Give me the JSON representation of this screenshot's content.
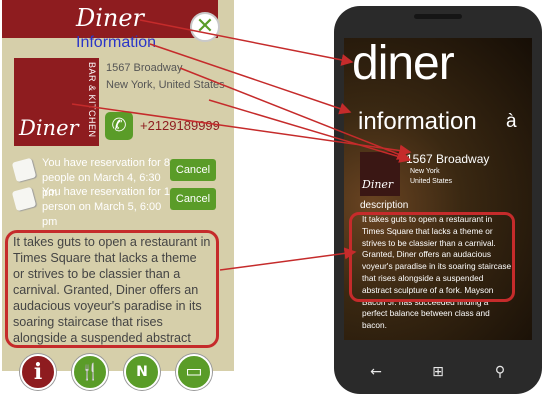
{
  "left_app": {
    "header_title": "Diner",
    "close_glyph": "✕",
    "section_label": "Information",
    "logo": {
      "name": "Diner",
      "subtitle": "BAR & KITCHEN"
    },
    "address_line1": "1567 Broadway",
    "address_line2": "New York, United States",
    "phone": "+2129189999",
    "reservations": [
      {
        "text": "You have reservation for 8 people on March 4, 6:30 pm",
        "button": "Cancel"
      },
      {
        "text": "You have reservation for 1 person on March 5, 6:00 pm",
        "button": "Cancel"
      }
    ],
    "description": "It takes guts to open a restaurant in Times Square that lacks a theme or strives to be classier than a carnival. Granted, Diner offers an audacious voyeur's paradise in its soaring staircase that rises alongside a suspended abstract sculpture of a fork. Mavson Bacon Jr. has",
    "nav": [
      {
        "icon": "info-icon",
        "glyph": "i"
      },
      {
        "icon": "fork-knife-icon",
        "glyph": "🍴"
      },
      {
        "icon": "compass-icon",
        "glyph": "N"
      },
      {
        "icon": "document-icon",
        "glyph": "▭"
      }
    ]
  },
  "phone": {
    "app_title": "diner",
    "section_title": "information",
    "next_section_peek": "à",
    "logo_name": "Diner",
    "address_line1": "1567 Broadway",
    "address_line2": "New York",
    "address_line3": "United States",
    "description_heading": "description",
    "description": "It takes guts to open a restaurant in Times Square that lacks a theme or strives to be classier than a carnival. Granted, Diner offers an audacious voyeur's paradise in its soaring staircase that rises alongside a suspended abstract sculpture of a fork. Mayson Bacon Jr. has succeeded finding a perfect balance between class and bacon.",
    "hw_buttons": [
      {
        "icon": "back-icon",
        "glyph": "←"
      },
      {
        "icon": "windows-icon",
        "glyph": "⊞"
      },
      {
        "icon": "search-icon",
        "glyph": "⚲"
      }
    ]
  },
  "colors": {
    "brand_red": "#8e1c1f",
    "accent_green": "#5a9c28",
    "panel_tan": "#d6cfaa",
    "annotation_red": "#c52b2b",
    "label_blue": "#2a35c8"
  }
}
